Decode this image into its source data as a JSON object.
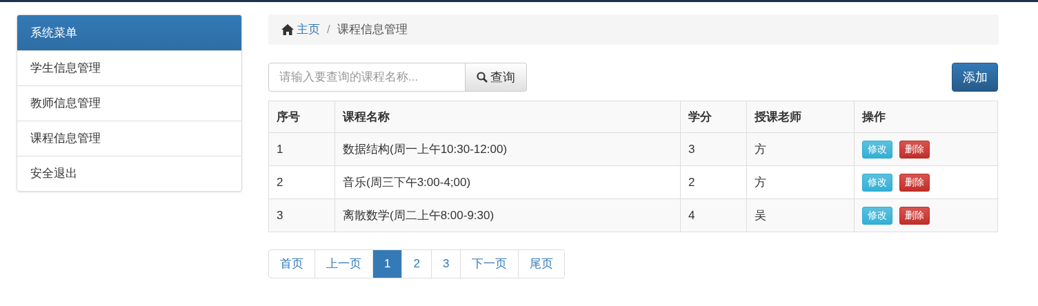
{
  "sidebar": {
    "title": "系统菜单",
    "items": [
      {
        "label": "学生信息管理"
      },
      {
        "label": "教师信息管理"
      },
      {
        "label": "课程信息管理"
      },
      {
        "label": "安全退出"
      }
    ]
  },
  "breadcrumb": {
    "home": "主页",
    "separator": "/",
    "current": "课程信息管理"
  },
  "search": {
    "placeholder": "请输入要查询的课程名称...",
    "button": "查询"
  },
  "add_button": "添加",
  "table": {
    "columns": [
      "序号",
      "课程名称",
      "学分",
      "授课老师",
      "操作"
    ],
    "rows": [
      {
        "cells": [
          "1",
          "数据结构(周一上午10:30-12:00)",
          "3",
          "方"
        ],
        "actions": [
          "修改",
          "删除"
        ]
      },
      {
        "cells": [
          "2",
          "音乐(周三下午3:00-4;00)",
          "2",
          "方"
        ],
        "actions": [
          "修改",
          "删除"
        ]
      },
      {
        "cells": [
          "3",
          "离散数学(周二上午8:00-9:30)",
          "4",
          "吴"
        ],
        "actions": [
          "修改",
          "删除"
        ]
      }
    ]
  },
  "pagination": [
    {
      "label": "首页",
      "selected": false
    },
    {
      "label": "上一页",
      "selected": false
    },
    {
      "label": "1",
      "selected": true
    },
    {
      "label": "2",
      "selected": false
    },
    {
      "label": "3",
      "selected": false
    },
    {
      "label": "下一页",
      "selected": false
    },
    {
      "label": "尾页",
      "selected": false
    }
  ]
}
